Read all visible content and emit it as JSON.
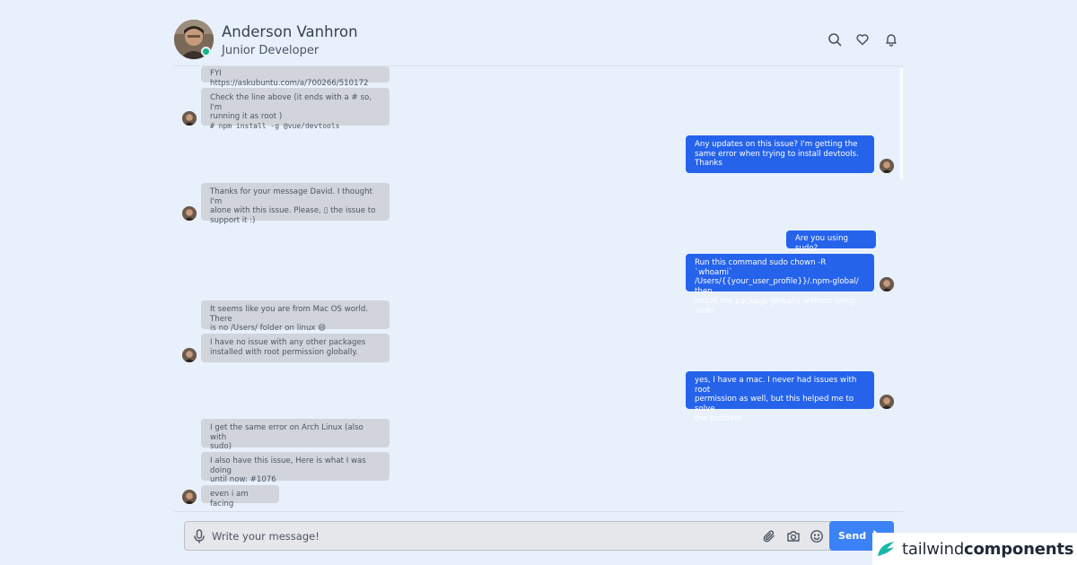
{
  "header": {
    "name": "Anderson Vanhron",
    "role": "Junior Developer",
    "icons": [
      "search-icon",
      "heart-icon",
      "bell-icon"
    ]
  },
  "messages": {
    "m1": "FYI https://askubuntu.com/a/700266/510172",
    "m2_l1": "Check the line above (it ends with a # so, I'm",
    "m2_l2": "running it as root )",
    "m2_code": "# npm install -g @vue/devtools",
    "m3_l1": "Any updates on this issue? I'm getting the",
    "m3_l2": "same error when trying to install devtools.",
    "m3_l3": "Thanks",
    "m4_l1": "Thanks for your message David. I thought I'm",
    "m4_l2": "alone with this issue. Please, ▯ the issue to",
    "m4_l3": "support it :)",
    "m5": "Are you using sudo?",
    "m6_l1": "Run this command sudo chown -R `whoami`",
    "m6_l2": "/Users/{{your_user_profile}}/.npm-global/ then",
    "m6_l3": "install the package globally without using sudo",
    "m7_l1": "It seems like you are from Mac OS world. There",
    "m7_l2": "is no /Users/ folder on linux 😄",
    "m8_l1": "I have no issue with any other packages",
    "m8_l2": "installed with root permission globally.",
    "m9_l1": "yes, I have a mac. I never had issues with root",
    "m9_l2": "permission as well, but this helped me to solve",
    "m9_l3": "the problem",
    "m10_l1": "I get the same error on Arch Linux (also with",
    "m10_l2": "sudo)",
    "m11_l1": "I also have this issue, Here is what I was doing",
    "m11_l2": "until now: #1076",
    "m12": "even i am facing"
  },
  "composer": {
    "placeholder": "Write your message!",
    "send_label": "Send",
    "icons": [
      "microphone-icon",
      "paperclip-icon",
      "camera-icon",
      "smiley-icon",
      "send-arrow-icon"
    ]
  },
  "brand": {
    "light": "tailwind",
    "bold": "components"
  },
  "colors": {
    "background": "#e8f0fb",
    "incoming_bubble": "#d1d5db",
    "outgoing_bubble": "#2563eb",
    "send_button": "#3b82f6",
    "online": "#10b981",
    "brand_accent": "#14b8a6"
  }
}
